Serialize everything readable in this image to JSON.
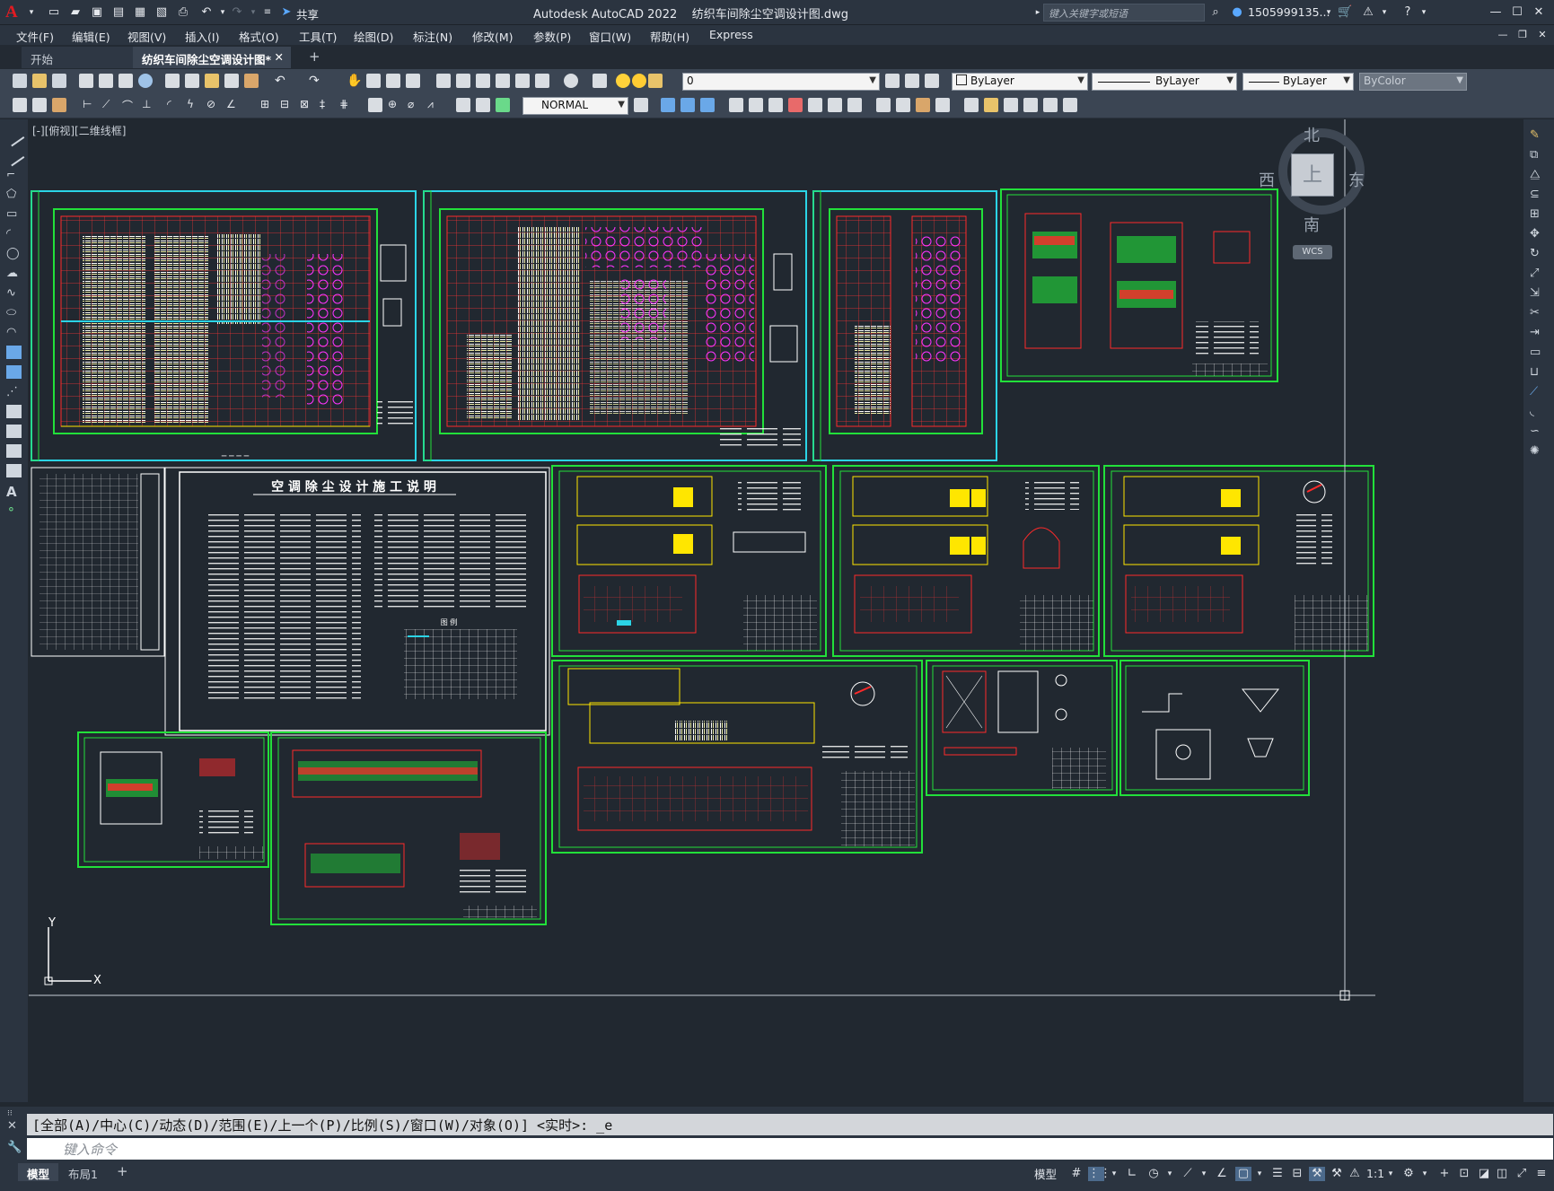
{
  "window": {
    "app_title": "Autodesk AutoCAD 2022",
    "file_name": "纺织车间除尘空调设计图.dwg",
    "share_label": "共享",
    "search_placeholder": "键入关键字或短语",
    "user_name": "1505999135..."
  },
  "menu": [
    "文件(F)",
    "编辑(E)",
    "视图(V)",
    "插入(I)",
    "格式(O)",
    "工具(T)",
    "绘图(D)",
    "标注(N)",
    "修改(M)",
    "参数(P)",
    "窗口(W)",
    "帮助(H)",
    "Express"
  ],
  "tabs": {
    "start": "开始",
    "active": "纺织车间除尘空调设计图*",
    "add": "+"
  },
  "toolbar": {
    "layer_value": "0",
    "color_value": "ByLayer",
    "linetype_value": "ByLayer",
    "lineweight_value": "ByLayer",
    "plotstyle_value": "ByColor",
    "dimstyle_value": "NORMAL"
  },
  "viewport": {
    "label": "[-][俯视][二维线框]",
    "compass_n": "北",
    "compass_s": "南",
    "compass_e": "东",
    "compass_w": "西",
    "cube_face": "上",
    "wcs": "WCS",
    "ucs_x": "X",
    "ucs_y": "Y"
  },
  "drawing": {
    "sheet_title_main": "空 调 除 尘 设 计 施 工 说 明",
    "legend_title": "图    例"
  },
  "command": {
    "history": "[全部(A)/中心(C)/动态(D)/范围(E)/上一个(P)/比例(S)/窗口(W)/对象(O)] <实时>: _e",
    "placeholder": "键入命令"
  },
  "layout_tabs": [
    "模型",
    "布局1",
    "+"
  ],
  "status": {
    "model_label": "模型",
    "scale": "1:1"
  },
  "colors": {
    "canvas": "#212830",
    "frame_cyan": "#2bd4e6",
    "frame_green": "#22e03a",
    "red": "#ff2a2a",
    "yellow": "#ffe600",
    "magenta": "#ff2aff",
    "white": "#ffffff"
  }
}
